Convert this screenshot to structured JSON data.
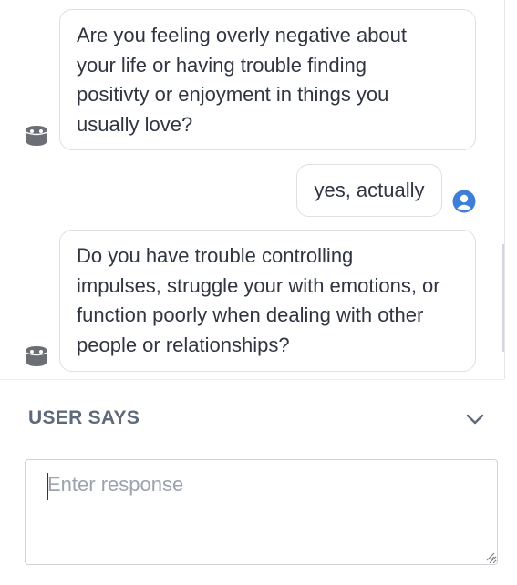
{
  "conversation": {
    "messages": [
      {
        "sender": "bot",
        "text": "Are you feeling overly negative about\nyour life or having trouble finding\npositivty or enjoyment in things you\nusually love?"
      },
      {
        "sender": "user",
        "text": "yes, actually"
      },
      {
        "sender": "bot",
        "text": "Do you have trouble controlling\nimpulses, struggle your with emotions, or\nfunction poorly when dealing with other\npeople or relationships?"
      }
    ],
    "bot_avatar_icon": "robot-head-icon",
    "user_avatar_icon": "user-circle-icon"
  },
  "composer": {
    "title": "USER SAYS",
    "collapse_icon": "chevron-down-icon",
    "input": {
      "value": "",
      "placeholder": "Enter response"
    }
  },
  "colors": {
    "bubble_border": "#dcdfe4",
    "bot_avatar": "#6b6f75",
    "user_avatar": "#3d7fd6",
    "title_text": "#5d6a7a"
  }
}
